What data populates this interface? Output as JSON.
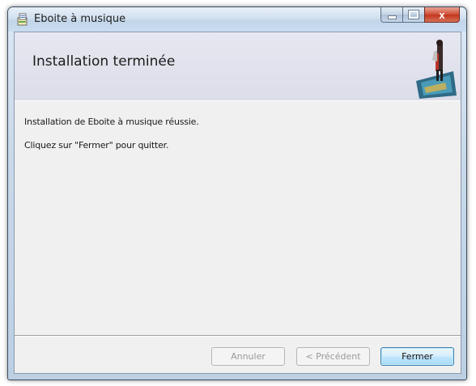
{
  "window": {
    "title": "Eboite à musique",
    "icons": {
      "app": "installer-icon",
      "minimize": "minimize-icon",
      "maximize": "maximize-icon",
      "close": "close-icon"
    },
    "close_glyph": "x"
  },
  "banner": {
    "title": "Installation terminée",
    "image": "banner-image"
  },
  "body": {
    "line1": "Installation de Eboite à musique réussie.",
    "line2": "Cliquez sur \"Fermer\" pour quitter."
  },
  "buttons": {
    "cancel": "Annuler",
    "previous": "< Précédent",
    "close": "Fermer"
  },
  "colors": {
    "close_button": "#c4371d",
    "primary_button_border": "#3c7fb1",
    "banner_bg": "#e6e7f0",
    "client_bg": "#f0f0f0"
  }
}
